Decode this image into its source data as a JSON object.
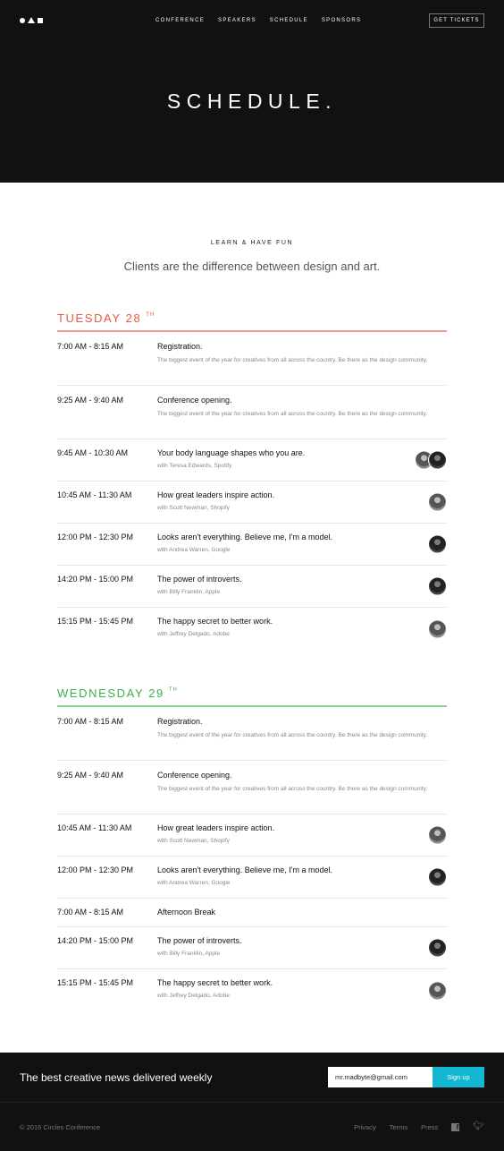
{
  "nav": {
    "items": [
      "Conference",
      "Speakers",
      "Schedule",
      "Sponsors"
    ],
    "cta": "Get Tickets"
  },
  "hero": {
    "title": "SCHEDULE."
  },
  "intro": {
    "kicker": "LEARN & HAVE FUN",
    "tagline": "Clients are the difference between design and art."
  },
  "days": [
    {
      "label": "TUESDAY 28",
      "suffix": "TH",
      "color": "#e8573f",
      "sessions": [
        {
          "time": "7:00 AM - 8:15 AM",
          "title": "Registration.",
          "desc": "The biggest event of the year for creatives from all across the country. Be there as the design community."
        },
        {
          "time": "9:25 AM - 9:40 AM",
          "title": "Conference opening.",
          "desc": "The biggest event of the year for creatives from all across the country. Be there as the design community."
        },
        {
          "time": "9:45 AM - 10:30 AM",
          "title": "Your body language shapes who you are.",
          "sub": "with Teresa Edwards, Spotify"
        },
        {
          "time": "10:45 AM - 11:30 AM",
          "title": "How great leaders inspire action.",
          "sub": "with Scott Newman, Shopify"
        },
        {
          "time": "12:00 PM - 12:30 PM",
          "title": "Looks aren't everything. Believe me, I'm a model.",
          "sub": "with Andrea Warren, Google"
        },
        {
          "time": "14:20 PM - 15:00 PM",
          "title": "The power of introverts.",
          "sub": "with Billy Franklin, Apple"
        },
        {
          "time": "15:15 PM - 15:45 PM",
          "title": "The happy secret to better work.",
          "sub": "with Jeffrey Delgado, Adobe"
        }
      ]
    },
    {
      "label": "WEDNESDAY 29",
      "suffix": "TH",
      "color": "#3eae4a",
      "sessions": [
        {
          "time": "7:00 AM - 8:15 AM",
          "title": "Registration.",
          "desc": "The biggest event of the year for creatives from all across the country. Be there as the design community."
        },
        {
          "time": "9:25 AM - 9:40 AM",
          "title": "Conference opening.",
          "desc": "The biggest event of the year for creatives from all across the country. Be there as the design community."
        },
        {
          "time": "10:45 AM - 11:30 AM",
          "title": "How great leaders inspire action.",
          "sub": "with Scott Newman, Shopify"
        },
        {
          "time": "12:00 PM - 12:30 PM",
          "title": "Looks aren't everything. Believe me, I'm a model.",
          "sub": "with Andrea Warren, Google"
        },
        {
          "time": "7:00 AM - 8:15 AM",
          "title": "Afternoon Break"
        },
        {
          "time": "14:20 PM - 15:00 PM",
          "title": "The power of introverts.",
          "sub": "with Billy Franklin, Apple"
        },
        {
          "time": "15:15 PM - 15:45 PM",
          "title": "The happy secret to better work.",
          "sub": "with Jeffrey Delgado, Adobe"
        }
      ]
    }
  ],
  "newsletter": {
    "text": "The best creative news delivered weekly",
    "email_value": "mr.madbyte@gmail.com",
    "button": "Sign up"
  },
  "footer": {
    "copyright": "© 2016 Circles Conference",
    "links": [
      "Privacy",
      "Terms",
      "Press"
    ]
  }
}
